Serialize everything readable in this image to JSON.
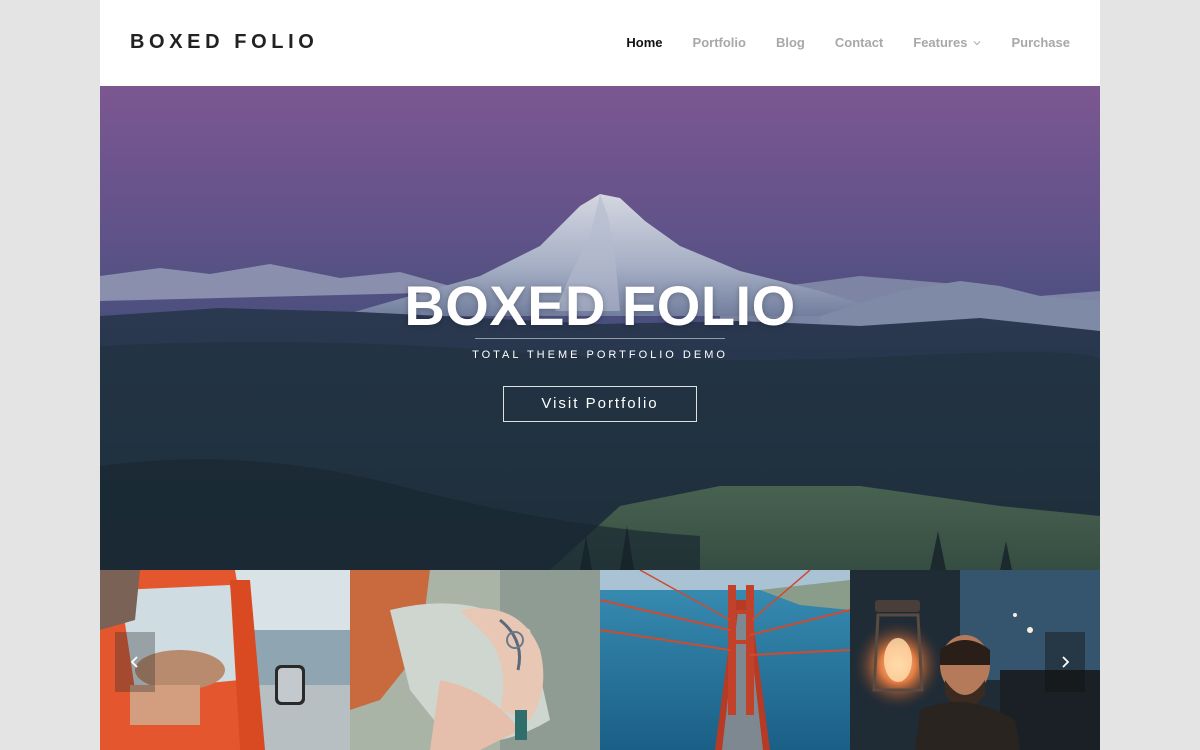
{
  "header": {
    "logo": "BOXED FOLIO",
    "nav": [
      {
        "label": "Home",
        "active": true
      },
      {
        "label": "Portfolio",
        "active": false
      },
      {
        "label": "Blog",
        "active": false
      },
      {
        "label": "Contact",
        "active": false
      },
      {
        "label": "Features",
        "active": false,
        "has_dropdown": true
      },
      {
        "label": "Purchase",
        "active": false
      }
    ]
  },
  "hero": {
    "title": "BOXED FOLIO",
    "subtitle": "TOTAL THEME PORTFOLIO DEMO",
    "button_label": "Visit Portfolio"
  },
  "gallery": {
    "items": [
      {
        "icon": "car-window-photo"
      },
      {
        "icon": "tattoo-photo"
      },
      {
        "icon": "bridge-photo"
      },
      {
        "icon": "lantern-photo"
      }
    ],
    "prev_icon": "chevron-left-icon",
    "next_icon": "chevron-right-icon"
  },
  "colors": {
    "page_bg": "#e4e4e4",
    "nav_active": "#111111",
    "nav_inactive": "#a8a8a8",
    "logo": "#222222"
  }
}
